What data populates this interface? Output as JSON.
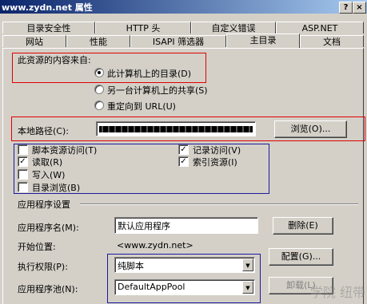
{
  "window": {
    "title": "www.zydn.net 属性",
    "help_glyph": "?",
    "close_glyph": "×"
  },
  "tabs_row1": [
    "目录安全性",
    "HTTP 头",
    "自定义错误",
    "ASP.NET"
  ],
  "tabs_row2": [
    "网站",
    "性能",
    "ISAPI 筛选器",
    "主目录",
    "文档"
  ],
  "active_tab": "主目录",
  "content_source": {
    "heading": "此资源的内容来自:",
    "options": [
      {
        "label": "此计算机上的目录(D)",
        "selected": true
      },
      {
        "label": "另一台计算机上的共享(S)",
        "selected": false
      },
      {
        "label": "重定向到 URL(U)",
        "selected": false
      }
    ]
  },
  "local_path": {
    "label": "本地路径(C):",
    "browse_label": "浏览(O)..."
  },
  "permissions": [
    {
      "label": "脚本资源访问(T)",
      "checked": false
    },
    {
      "label": "记录访问(V)",
      "checked": true
    },
    {
      "label": "读取(R)",
      "checked": true
    },
    {
      "label": "索引资源(I)",
      "checked": true
    },
    {
      "label": "写入(W)",
      "checked": false
    },
    {
      "label": "目录浏览(B)",
      "checked": false
    }
  ],
  "app_settings": {
    "heading": "应用程序设置",
    "app_name_label": "应用程序名(M):",
    "app_name_value": "默认应用程序",
    "remove_label": "删除(E)",
    "start_label": "开始位置:",
    "start_value": "<www.zydn.net>",
    "config_label": "配置(G)...",
    "exec_label": "执行权限(P):",
    "exec_value": "纯脚本",
    "pool_label": "应用程序池(N):",
    "pool_value": "DefaultAppPool",
    "unload_label": "卸载(L)"
  },
  "watermark": "学院 纽带"
}
